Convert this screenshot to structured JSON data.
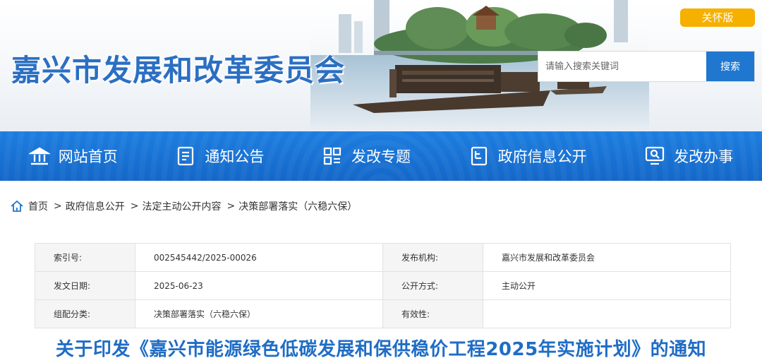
{
  "header": {
    "site_title": "嘉兴市发展和改革委员会",
    "care_button": "关怀版",
    "search": {
      "placeholder": "请输入搜索关键词",
      "button": "搜索"
    }
  },
  "nav": {
    "items": [
      {
        "label": "网站首页",
        "icon": "building-icon"
      },
      {
        "label": "通知公告",
        "icon": "document-icon"
      },
      {
        "label": "发改专题",
        "icon": "grid-icon"
      },
      {
        "label": "政府信息公开",
        "icon": "info-card-icon"
      },
      {
        "label": "发改办事",
        "icon": "monitor-search-icon"
      }
    ]
  },
  "breadcrumb": {
    "items": [
      "首页",
      "政府信息公开",
      "法定主动公开内容",
      "决策部署落实（六稳六保）"
    ],
    "separator": ">"
  },
  "info": {
    "rows": [
      {
        "l1": "索引号:",
        "v1": "002545442/2025-00026",
        "l2": "发布机构:",
        "v2": "嘉兴市发展和改革委员会"
      },
      {
        "l1": "发文日期:",
        "v1": "2025-06-23",
        "l2": "公开方式:",
        "v2": "主动公开"
      },
      {
        "l1": "组配分类:",
        "v1": "决策部署落实（六稳六保）",
        "l2": "有效性:",
        "v2": ""
      }
    ]
  },
  "document": {
    "title": "关于印发《嘉兴市能源绿色低碳发展和保供稳价工程2025年实施计划》的通知"
  },
  "colors": {
    "brand_blue": "#1f77d0",
    "title_blue": "#1f6dc5",
    "care_orange": "#f5b000"
  }
}
